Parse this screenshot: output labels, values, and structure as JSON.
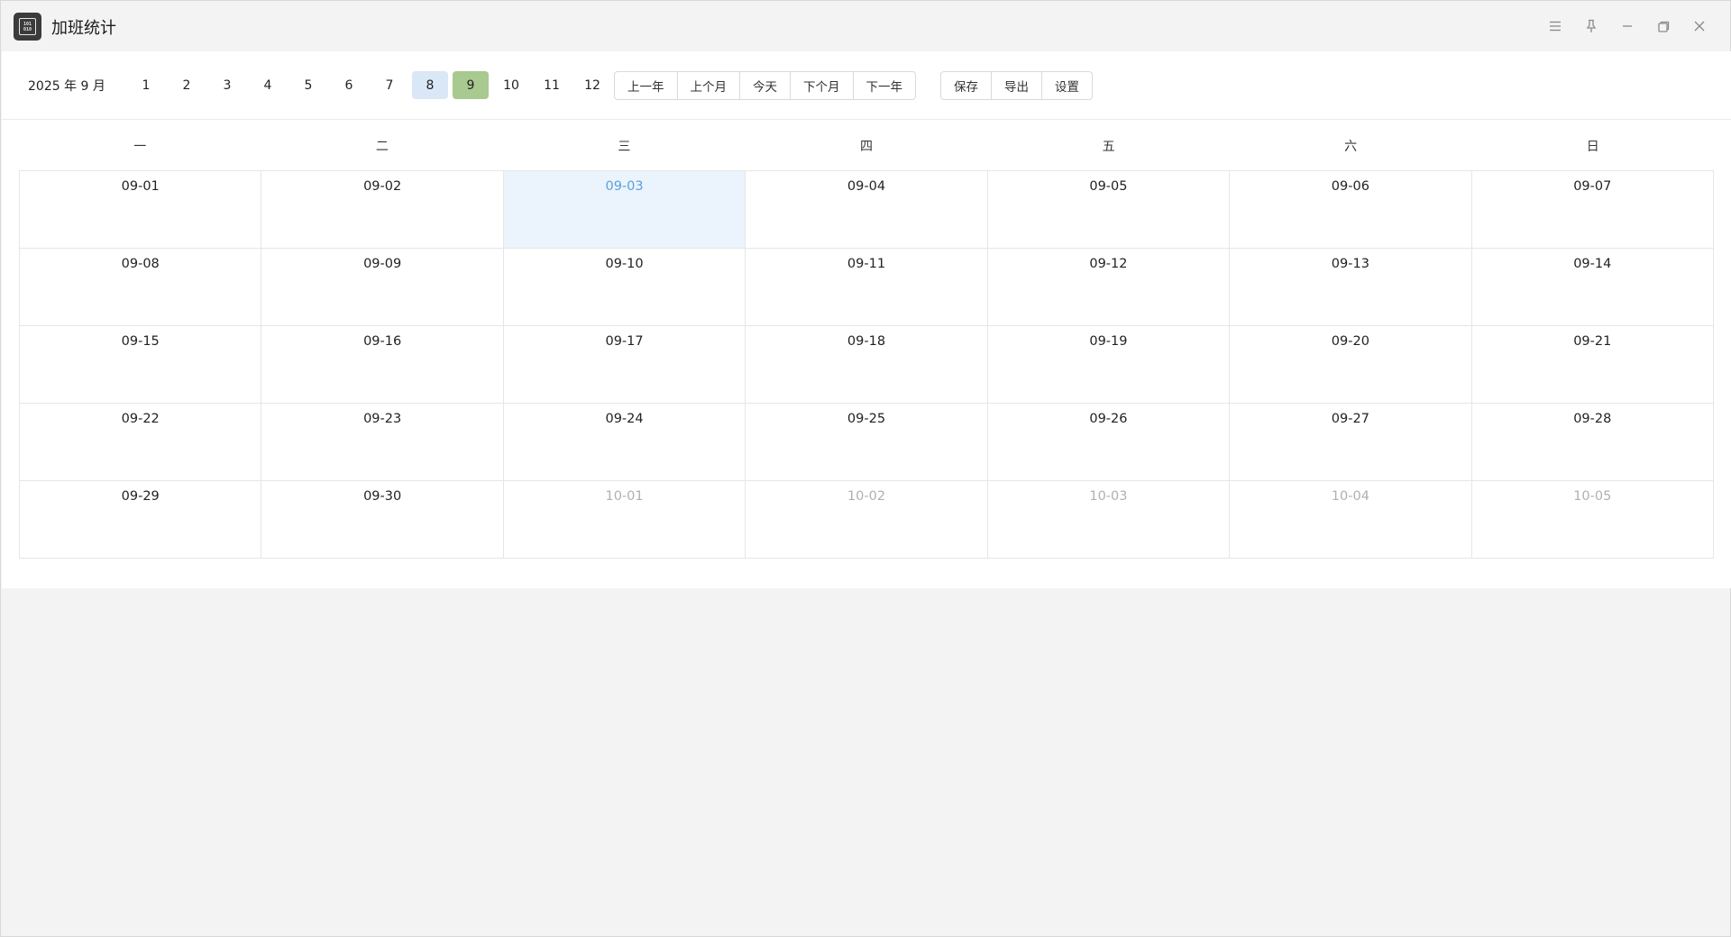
{
  "app": {
    "title": "加班统计",
    "icon": "calculator-icon",
    "icon_glyph_rows": [
      "101",
      "010"
    ]
  },
  "window_controls": [
    "menu-icon",
    "pin-icon",
    "minimize-icon",
    "restore-icon",
    "close-icon"
  ],
  "toolbar": {
    "year_month": "2025 年 9 月",
    "months": [
      "1",
      "2",
      "3",
      "4",
      "5",
      "6",
      "7",
      "8",
      "9",
      "10",
      "11",
      "12"
    ],
    "previous_month": "8",
    "selected_month": "9",
    "nav_buttons": [
      "上一年",
      "上个月",
      "今天",
      "下个月",
      "下一年"
    ],
    "action_buttons": [
      "保存",
      "导出",
      "设置"
    ]
  },
  "calendar": {
    "weekdays": [
      "一",
      "二",
      "三",
      "四",
      "五",
      "六",
      "日"
    ],
    "today": "09-03",
    "days": [
      {
        "label": "09-01",
        "other": false
      },
      {
        "label": "09-02",
        "other": false
      },
      {
        "label": "09-03",
        "other": false
      },
      {
        "label": "09-04",
        "other": false
      },
      {
        "label": "09-05",
        "other": false
      },
      {
        "label": "09-06",
        "other": false
      },
      {
        "label": "09-07",
        "other": false
      },
      {
        "label": "09-08",
        "other": false
      },
      {
        "label": "09-09",
        "other": false
      },
      {
        "label": "09-10",
        "other": false
      },
      {
        "label": "09-11",
        "other": false
      },
      {
        "label": "09-12",
        "other": false
      },
      {
        "label": "09-13",
        "other": false
      },
      {
        "label": "09-14",
        "other": false
      },
      {
        "label": "09-15",
        "other": false
      },
      {
        "label": "09-16",
        "other": false
      },
      {
        "label": "09-17",
        "other": false
      },
      {
        "label": "09-18",
        "other": false
      },
      {
        "label": "09-19",
        "other": false
      },
      {
        "label": "09-20",
        "other": false
      },
      {
        "label": "09-21",
        "other": false
      },
      {
        "label": "09-22",
        "other": false
      },
      {
        "label": "09-23",
        "other": false
      },
      {
        "label": "09-24",
        "other": false
      },
      {
        "label": "09-25",
        "other": false
      },
      {
        "label": "09-26",
        "other": false
      },
      {
        "label": "09-27",
        "other": false
      },
      {
        "label": "09-28",
        "other": false
      },
      {
        "label": "09-29",
        "other": false
      },
      {
        "label": "09-30",
        "other": false
      },
      {
        "label": "10-01",
        "other": true
      },
      {
        "label": "10-02",
        "other": true
      },
      {
        "label": "10-03",
        "other": true
      },
      {
        "label": "10-04",
        "other": true
      },
      {
        "label": "10-05",
        "other": true
      }
    ]
  },
  "colors": {
    "today_bg": "#ebf3fd",
    "today_text": "#5aa0dc",
    "selected_month_bg": "#a8c98f",
    "previous_month_bg": "#d9e7f7",
    "other_month_text": "#b0b0b0"
  }
}
